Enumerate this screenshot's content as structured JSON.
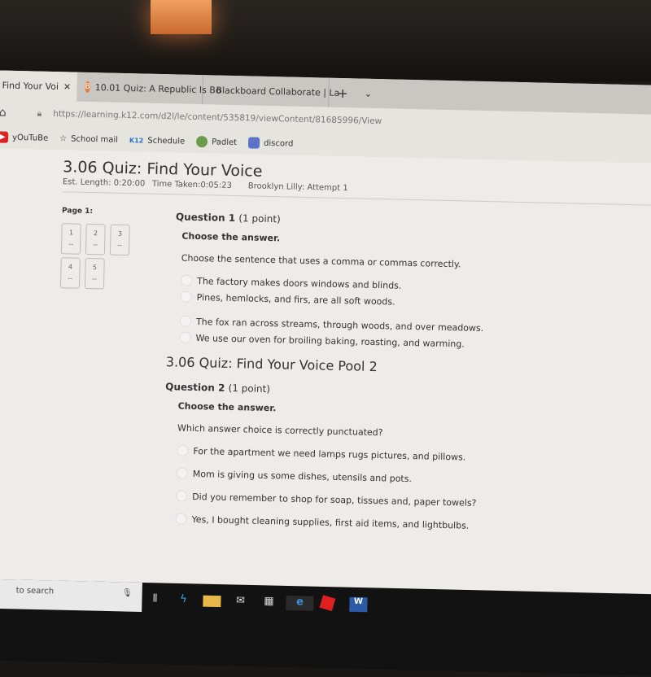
{
  "browser": {
    "tabs": [
      {
        "label": "z: Find Your Voi",
        "active": true,
        "close": "✕"
      },
      {
        "label": "10.01 Quiz: A Republic Is Bo",
        "icon": "k12-icon"
      },
      {
        "label": "Blackboard Collaborate | La",
        "icon": "blackboard-icon"
      }
    ],
    "new_tab": "+",
    "tab_menu": "⌄",
    "url": "https://learning.k12.com/d2l/le/content/535819/viewContent/81685996/View",
    "bookmarks": [
      "yOuTuBe",
      "School mail",
      "Schedule",
      "Padlet",
      "discord"
    ],
    "bookmark_k12_logo": "K12"
  },
  "quiz": {
    "title": "3.06 Quiz: Find Your Voice",
    "est_length": "Est. Length: 0:20:00",
    "time_taken": "Time Taken:0:05:23",
    "attempt": "Brooklyn Lilly: Attempt 1",
    "page_label": "Page 1:",
    "question_nav": [
      {
        "n": "1",
        "s": "--"
      },
      {
        "n": "2",
        "s": "--"
      },
      {
        "n": "3",
        "s": "--"
      },
      {
        "n": "4",
        "s": "--"
      },
      {
        "n": "5",
        "s": "--"
      }
    ],
    "q1": {
      "title": "Question 1",
      "points": "(1 point)",
      "instruction": "Choose the answer.",
      "prompt": "Choose the sentence that uses a comma or commas correctly.",
      "options": [
        "The factory makes doors windows and blinds.",
        "Pines, hemlocks, and firs, are all soft woods.",
        "The fox ran across streams, through woods, and over meadows.",
        "We use our oven for broiling baking, roasting, and warming."
      ]
    },
    "pool_title": "3.06 Quiz: Find Your Voice Pool 2",
    "q2": {
      "title": "Question 2",
      "points": "(1 point)",
      "instruction": "Choose the answer.",
      "prompt": "Which answer choice is correctly punctuated?",
      "options": [
        "For the apartment we need lamps rugs pictures, and pillows.",
        "Mom is giving us some dishes, utensils and pots.",
        "Did you remember to shop for soap, tissues and, paper towels?",
        "Yes, I bought cleaning supplies, first aid items, and lightbulbs."
      ]
    }
  },
  "taskbar": {
    "search_placeholder": "to search"
  }
}
